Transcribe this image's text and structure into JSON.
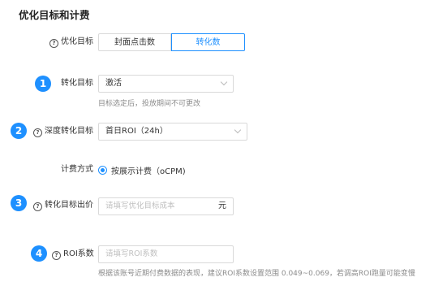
{
  "section": {
    "title": "优化目标和计费"
  },
  "opt_goal": {
    "label": "优化目标",
    "options": [
      "封面点击数",
      "转化数"
    ],
    "selected_index": 1
  },
  "conversion_goal": {
    "step": "1",
    "label": "转化目标",
    "value": "激活",
    "hint": "目标选定后，投放期间不可更改"
  },
  "deep_conversion_goal": {
    "step": "2",
    "label": "深度转化目标",
    "value": "首日ROI（24h）"
  },
  "billing": {
    "label": "计费方式",
    "option": "按展示计费（oCPM)",
    "selected": true
  },
  "conversion_bid": {
    "step": "3",
    "label": "转化目标出价",
    "placeholder": "请填写优化目标成本",
    "suffix": "元"
  },
  "roi_coef": {
    "step": "4",
    "label": "ROI系数",
    "placeholder": "请填写ROI系数",
    "hint": "根据该账号近期付费数据的表现，建议ROI系数设置范围 0.049~0.069，若调高ROI跑量可能变慢"
  },
  "colors": {
    "accent": "#1e90ff",
    "border": "#d9d9d9",
    "hint_text": "#8c8c8c"
  },
  "icons": {
    "help": "question-circle-icon",
    "chevron": "chevron-down-icon"
  }
}
